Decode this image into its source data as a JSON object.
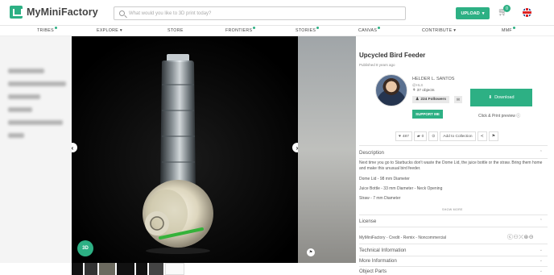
{
  "header": {
    "brand": "MyMiniFactory",
    "search_placeholder": "What would you like to 3D print today?",
    "upload_label": "UPLOAD",
    "cart_count": "0"
  },
  "nav": {
    "items": [
      {
        "label": "TRIBES",
        "dot": true
      },
      {
        "label": "EXPLORE ▾",
        "dot": false
      },
      {
        "label": "STORE",
        "dot": false
      },
      {
        "label": "FRONTIERS",
        "dot": true
      },
      {
        "label": "STORIES",
        "dot": true
      },
      {
        "label": "CANVAS",
        "dot": true
      },
      {
        "label": "CONTRIBUTE ▾",
        "dot": false
      },
      {
        "label": "MMF",
        "dot": true
      }
    ]
  },
  "viewer": {
    "badge_3d": "3D",
    "prev_icon": "‹",
    "next_icon": "›"
  },
  "object": {
    "title": "Upcycled Bird Feeder",
    "published": "Published 8 years ago",
    "author": "HELDER L. SANTOS",
    "handle": "@HLS",
    "objects": "37 objects",
    "followers": "224 Followers",
    "support_label": "SUPPORT ME",
    "download_label": "Download",
    "click_print": "Click & Print preview"
  },
  "stats": {
    "likes": "487",
    "comments": "0",
    "collection_label": "Add to Collection"
  },
  "sections": {
    "description": "Description",
    "desc_lines": [
      "Next time you go to Starbucks don't waste the Dome Lid, the juice bottle or the straw. Bring them home and make this unusual bird feeder.",
      "Dome Lid - 98 mm Diameter",
      "Juice Bottle - 33 mm Diameter - Neck Opening",
      "Straw - 7 mm Diameter"
    ],
    "show_more": "SHOW MORE",
    "license": "License",
    "license_text": "MyMiniFactory - Credit - Remix - Noncommercial",
    "technical": "Technical Information",
    "more_info": "More Information",
    "object_parts": "Object Parts"
  }
}
